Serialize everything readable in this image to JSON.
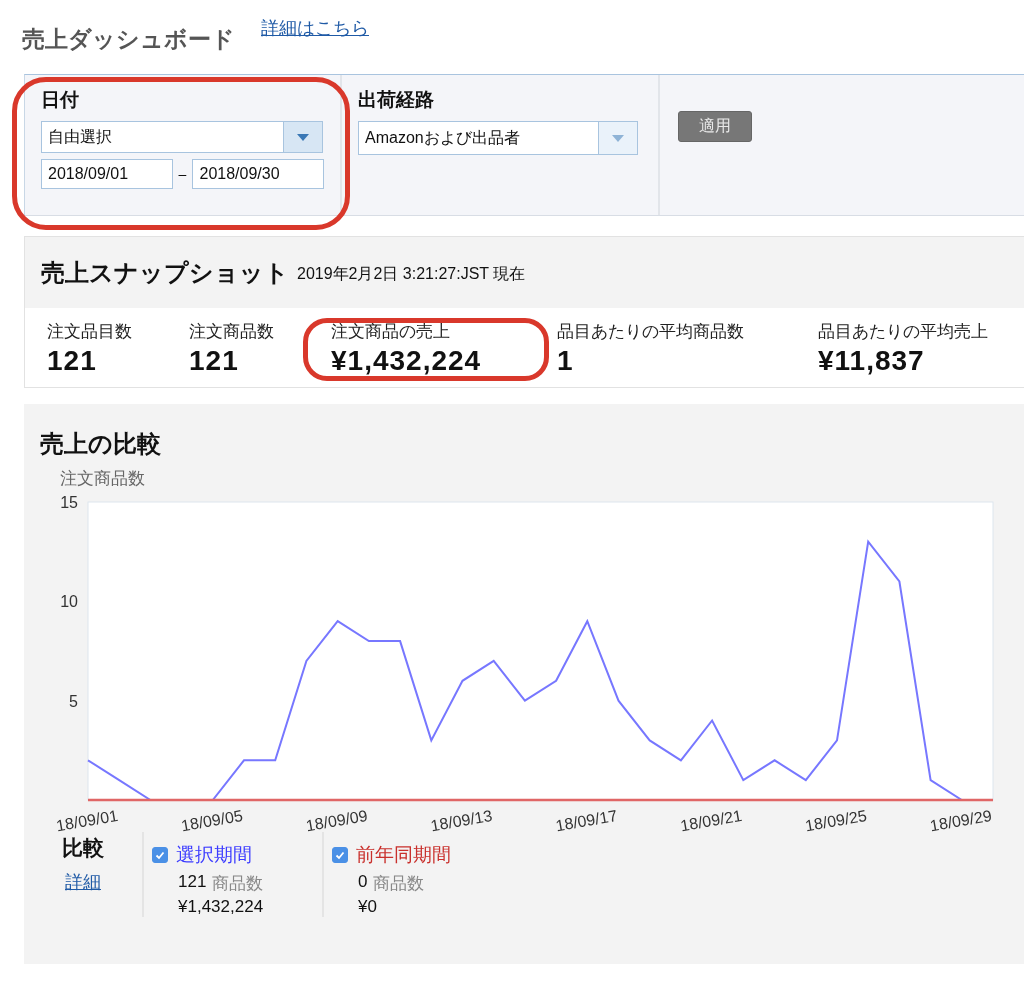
{
  "header": {
    "title": "売上ダッシュボード",
    "link": "詳細はこちら"
  },
  "filters": [
    {
      "kind": "date",
      "label": "日付",
      "highlighted": true,
      "select": "自由選択",
      "from": "2018/09/01",
      "separator": "–",
      "to": "2018/09/30"
    },
    {
      "kind": "select",
      "label": "出荷経路",
      "highlighted": false,
      "select": "Amazonおよび出品者"
    },
    {
      "kind": "button",
      "label": "適用"
    }
  ],
  "snapshot": {
    "title": "売上スナップショット",
    "timestamp": "2019年2月2日 3:21:27:JST 現在",
    "metrics": [
      {
        "label": "注文品目数",
        "value": "121",
        "highlighted": false
      },
      {
        "label": "注文商品数",
        "value": "121",
        "highlighted": false
      },
      {
        "label": "注文商品の売上",
        "value": "¥1,432,224",
        "highlighted": true
      },
      {
        "label": "品目あたりの平均商品数",
        "value": "1",
        "highlighted": false
      },
      {
        "label": "品目あたりの平均売上",
        "value": "¥11,837",
        "highlighted": false
      }
    ]
  },
  "comparison": {
    "title": "売上の比較",
    "chart_data": {
      "type": "line",
      "ylabel": "注文商品数",
      "categories": [
        "18/09/01",
        null,
        null,
        null,
        "18/09/05",
        null,
        null,
        null,
        "18/09/09",
        null,
        null,
        null,
        "18/09/13",
        null,
        null,
        null,
        "18/09/17",
        null,
        null,
        null,
        "18/09/21",
        null,
        null,
        null,
        "18/09/25",
        null,
        null,
        null,
        "18/09/29",
        null
      ],
      "ylim": [
        0,
        15
      ],
      "yticks": [
        5,
        10,
        15
      ],
      "series": [
        {
          "name": "選択期間",
          "color": "#7777ff",
          "values": [
            2,
            1,
            0,
            0,
            0,
            2,
            2,
            7,
            9,
            8,
            8,
            3,
            6,
            7,
            5,
            6,
            9,
            5,
            3,
            2,
            4,
            1,
            2,
            1,
            3,
            13,
            11,
            1,
            0,
            0
          ]
        },
        {
          "name": "前年同期間",
          "color": "#e06666",
          "values": [
            0,
            0,
            0,
            0,
            0,
            0,
            0,
            0,
            0,
            0,
            0,
            0,
            0,
            0,
            0,
            0,
            0,
            0,
            0,
            0,
            0,
            0,
            0,
            0,
            0,
            0,
            0,
            0,
            0,
            0
          ]
        }
      ]
    },
    "legend": {
      "title": "比較",
      "link": "詳細",
      "items": [
        {
          "color": "#3b3bff",
          "checked": true,
          "count": "121",
          "unit": "商品数",
          "sales": "¥1,432,224"
        },
        {
          "color": "#c9302c",
          "checked": true,
          "count": "0",
          "unit": "商品数",
          "sales": "¥0"
        }
      ]
    }
  }
}
